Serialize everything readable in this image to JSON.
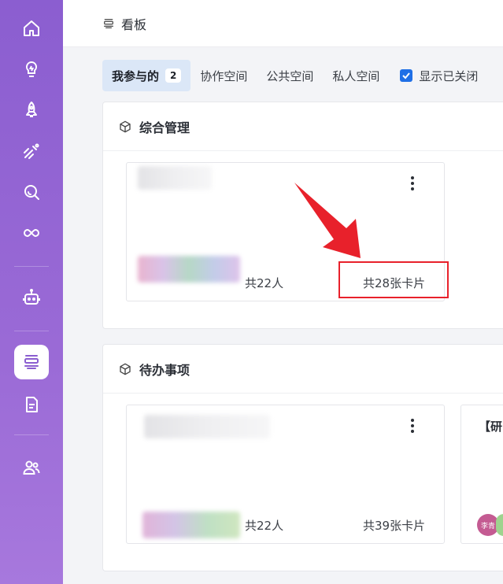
{
  "header": {
    "title": "看板"
  },
  "tabs": [
    {
      "label": "我参与的",
      "count": "2",
      "active": true
    },
    {
      "label": "协作空间"
    },
    {
      "label": "公共空间"
    },
    {
      "label": "私人空间"
    }
  ],
  "show_closed": {
    "label": "显示已关闭",
    "checked": true
  },
  "sections": [
    {
      "name": "综合管理",
      "cards": [
        {
          "members": "共22人",
          "cards_count": "共28张卡片"
        }
      ]
    },
    {
      "name": "待办事项",
      "cards": [
        {
          "members": "共22人",
          "cards_count": "共39张卡片"
        },
        {
          "title_partial": "【研",
          "avatar_text": "李青"
        }
      ]
    }
  ],
  "colors": {
    "accent": "#1f6fe6",
    "sidebar_top": "#8b5ed0",
    "sidebar_bottom": "#a778dd",
    "annotation": "#e8212b"
  },
  "icons": [
    "home-icon",
    "bulb-icon",
    "rocket-icon",
    "sprint-icon",
    "search-icon",
    "infinity-icon",
    "robot-icon",
    "board-icon",
    "document-icon",
    "users-icon"
  ]
}
